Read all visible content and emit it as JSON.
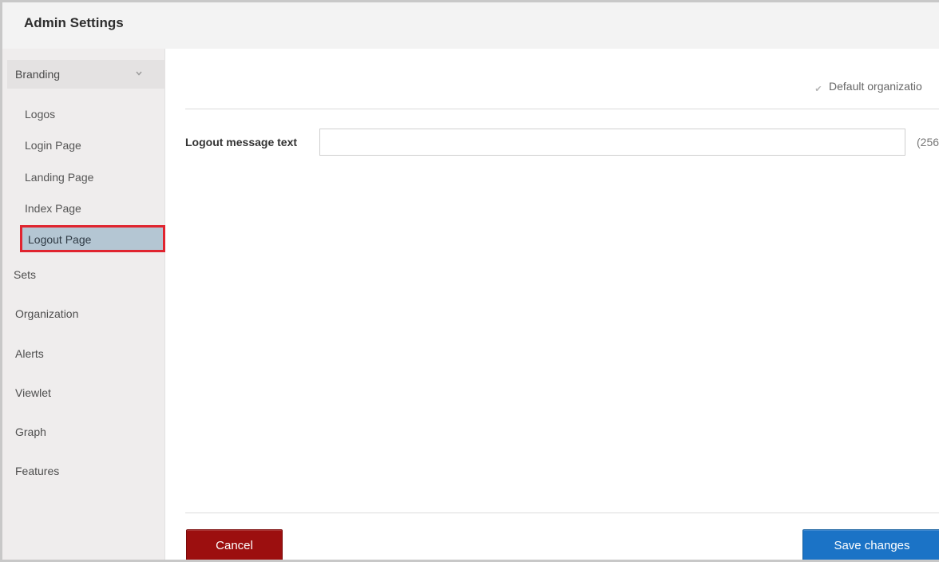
{
  "header": {
    "title": "Admin Settings"
  },
  "sidebar": {
    "section": {
      "label": "Branding",
      "expanded": true,
      "icon": "chevron-down-icon"
    },
    "sub_items": [
      {
        "label": "Logos"
      },
      {
        "label": "Login Page"
      },
      {
        "label": "Landing Page"
      },
      {
        "label": "Index Page"
      },
      {
        "label": "Logout Page",
        "selected": true
      }
    ],
    "items": [
      {
        "label": "Sets"
      },
      {
        "label": "Organization"
      },
      {
        "label": "Alerts"
      },
      {
        "label": "Viewlet"
      },
      {
        "label": "Graph"
      },
      {
        "label": "Features"
      }
    ]
  },
  "content": {
    "default_org": {
      "label": "Default organizatio",
      "checked": true,
      "disabled": true
    },
    "logout_message": {
      "label": "Logout message text",
      "value": "",
      "char_limit": "(256"
    }
  },
  "actions": {
    "cancel_label": "Cancel",
    "save_label": "Save changes"
  },
  "colors": {
    "selected_highlight": "#b4c6d3",
    "selected_border": "#e0242f",
    "cancel_button": "#9c0f0f",
    "save_button": "#1b73c6",
    "sidebar_bg": "#efeded",
    "header_bg": "#f3f3f3"
  }
}
